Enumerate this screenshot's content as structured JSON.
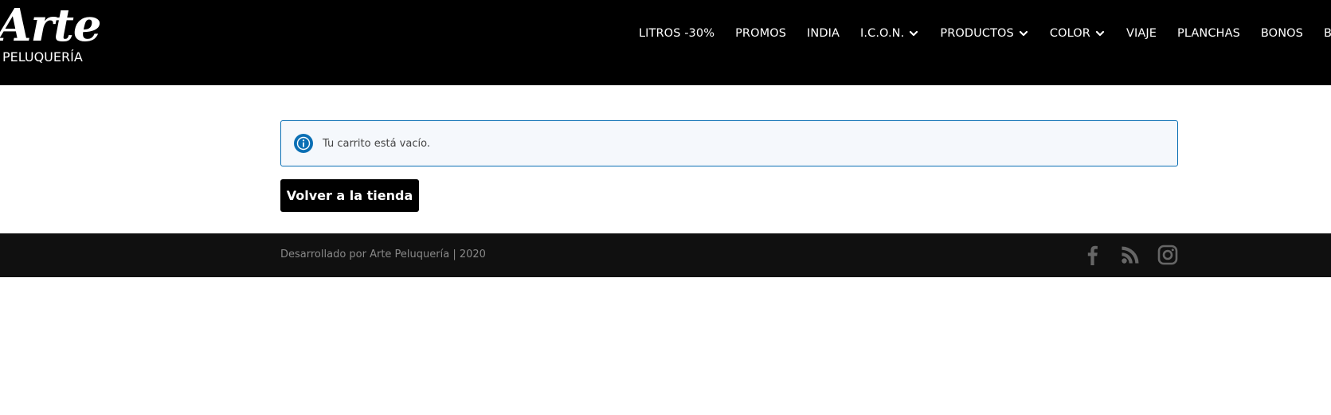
{
  "header": {
    "logo": {
      "title": "Arte",
      "subtitle": "PELUQUERÍA"
    },
    "nav": [
      {
        "label": "LITROS -30%",
        "has_dropdown": false
      },
      {
        "label": "PROMOS",
        "has_dropdown": false
      },
      {
        "label": "INDIA",
        "has_dropdown": false
      },
      {
        "label": "I.C.O.N.",
        "has_dropdown": true
      },
      {
        "label": "PRODUCTOS",
        "has_dropdown": true
      },
      {
        "label": "COLOR",
        "has_dropdown": true
      },
      {
        "label": "VIAJE",
        "has_dropdown": false
      },
      {
        "label": "PLANCHAS",
        "has_dropdown": false
      },
      {
        "label": "BONOS",
        "has_dropdown": false
      },
      {
        "label": "BL",
        "has_dropdown": false
      }
    ],
    "icons": {
      "dropdown": "chevron-down-icon"
    }
  },
  "main": {
    "notice": {
      "icon": "info-icon",
      "text": "Tu carrito está vacío."
    },
    "return_button": "Volver a la tienda"
  },
  "footer": {
    "credit": "Desarrollado por Arte Peluquería | 2020",
    "social": [
      "facebook-icon",
      "rss-icon",
      "instagram-icon"
    ]
  },
  "colors": {
    "header_bg": "#000000",
    "notice_border": "#0b6fb4",
    "notice_bg": "#f5f8fc",
    "info_icon": "#0b6fb4",
    "button_bg": "#000000",
    "footer_bg": "#101010",
    "footer_text": "#888888",
    "social_icon": "#666666"
  }
}
